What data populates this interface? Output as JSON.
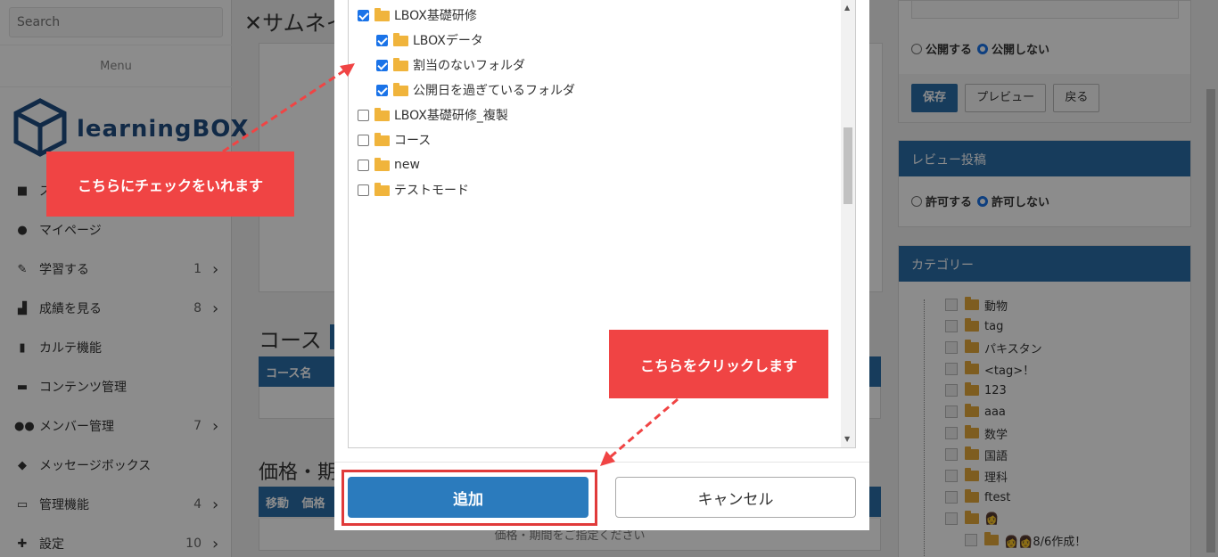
{
  "sidebar": {
    "search_placeholder": "Search",
    "menu_title": "Menu",
    "logo_text": "learningBOX",
    "items": [
      {
        "label": "ス",
        "icon": "book-icon",
        "count": "",
        "arrow": false
      },
      {
        "label": "マイページ",
        "icon": "user-icon",
        "count": "",
        "arrow": false
      },
      {
        "label": "学習する",
        "icon": "pencil-icon",
        "count": "1",
        "arrow": true
      },
      {
        "label": "成績を見る",
        "icon": "chart-icon",
        "count": "8",
        "arrow": true
      },
      {
        "label": "カルテ機能",
        "icon": "bars-icon",
        "count": "",
        "arrow": false
      },
      {
        "label": "コンテンツ管理",
        "icon": "folder-icon",
        "count": "",
        "arrow": false
      },
      {
        "label": "メンバー管理",
        "icon": "users-icon",
        "count": "7",
        "arrow": true
      },
      {
        "label": "メッセージボックス",
        "icon": "chat-icon",
        "count": "",
        "arrow": false
      },
      {
        "label": "管理機能",
        "icon": "monitor-icon",
        "count": "4",
        "arrow": true
      },
      {
        "label": "設定",
        "icon": "wrench-icon",
        "count": "10",
        "arrow": true
      }
    ]
  },
  "main": {
    "thumb_title": "サムネイ",
    "course_title": "コース",
    "course_header": "コース名",
    "price_title": "価格・期",
    "price_header_move": "移動",
    "price_header_price": "価格",
    "price_empty": "価格・期間をご指定ください"
  },
  "right": {
    "publish_yes": "公開する",
    "publish_no": "公開しない",
    "save_label": "保存",
    "preview_label": "プレビュー",
    "back_label": "戻る",
    "review_title": "レビュー投稿",
    "review_yes": "許可する",
    "review_no": "許可しない",
    "category_title": "カテゴリー",
    "categories": [
      "動物",
      "tag",
      "パキスタン",
      "<tag>！",
      "123",
      "aaa",
      "数学",
      "国語",
      "理科",
      "ftest",
      "👩",
      "👩👩8/6作成！"
    ]
  },
  "modal": {
    "tree": [
      {
        "label": "LBOX基礎研修",
        "checked": true,
        "level": 0
      },
      {
        "label": "LBOXデータ",
        "checked": true,
        "level": 1
      },
      {
        "label": "割当のないフォルダ",
        "checked": true,
        "level": 1
      },
      {
        "label": "公開日を過ぎているフォルダ",
        "checked": true,
        "level": 1
      },
      {
        "label": "LBOX基礎研修_複製",
        "checked": false,
        "level": 0
      },
      {
        "label": "コース",
        "checked": false,
        "level": 0
      },
      {
        "label": "new",
        "checked": false,
        "level": 0
      },
      {
        "label": "テストモード",
        "checked": false,
        "level": 0
      }
    ],
    "add_label": "追加",
    "cancel_label": "キャンセル"
  },
  "annotations": {
    "check_callout": "こちらにチェックをいれます",
    "click_callout": "こちらをクリックします"
  },
  "colors": {
    "primary": "#2b6da8",
    "callout": "#f04444",
    "checkbox": "#1a73e8",
    "folder": "#f0b43c"
  }
}
